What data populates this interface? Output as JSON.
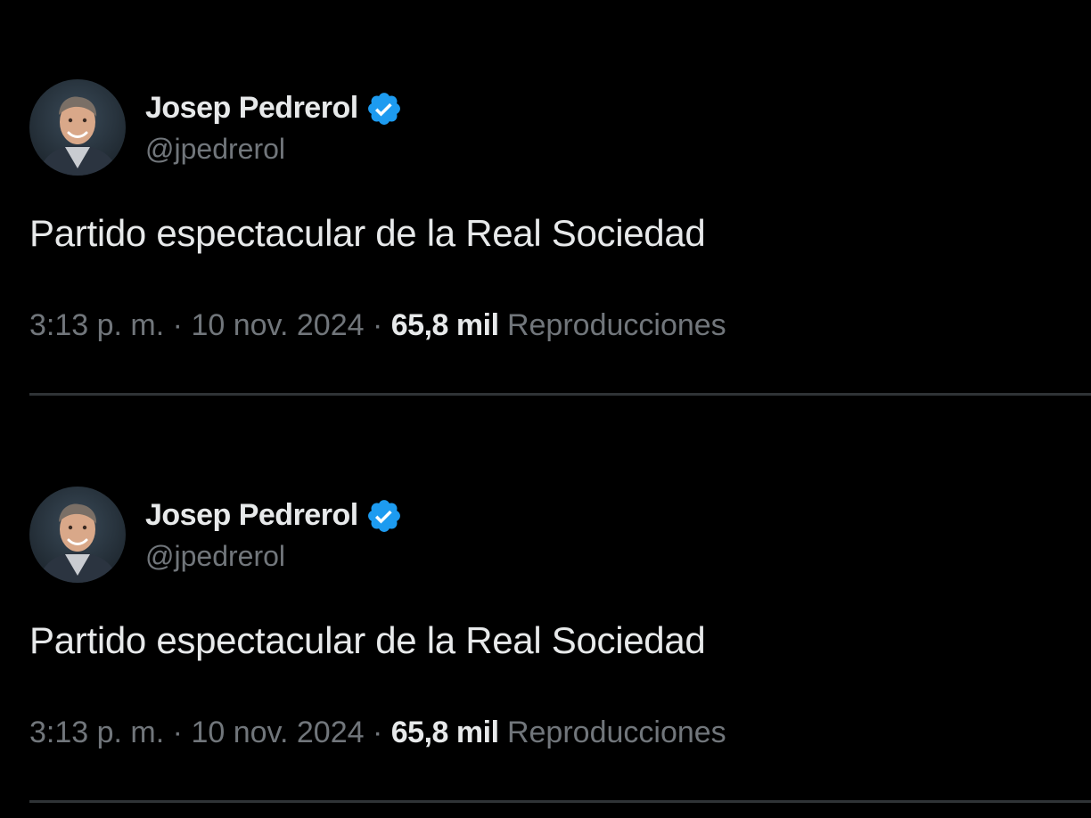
{
  "colors": {
    "background": "#000000",
    "primary_text": "#e7e9ea",
    "secondary_text": "#71767b",
    "verified_badge": "#1d9bf0",
    "divider": "#2f3336"
  },
  "tweets": [
    {
      "author": {
        "display_name": "Josep Pedrerol",
        "handle": "@jpedrerol",
        "verified": true,
        "verified_icon": "verified-badge-icon"
      },
      "text": "Partido espectacular de la Real Sociedad",
      "time": "3:13 p. m.",
      "separator": "·",
      "date": "10 nov. 2024",
      "views_count": "65,8 mil",
      "views_label": "Reproducciones"
    },
    {
      "author": {
        "display_name": "Josep Pedrerol",
        "handle": "@jpedrerol",
        "verified": true,
        "verified_icon": "verified-badge-icon"
      },
      "text": "Partido espectacular de la Real Sociedad",
      "time": "3:13 p. m.",
      "separator": "·",
      "date": "10 nov. 2024",
      "views_count": "65,8 mil",
      "views_label": "Reproducciones"
    }
  ]
}
